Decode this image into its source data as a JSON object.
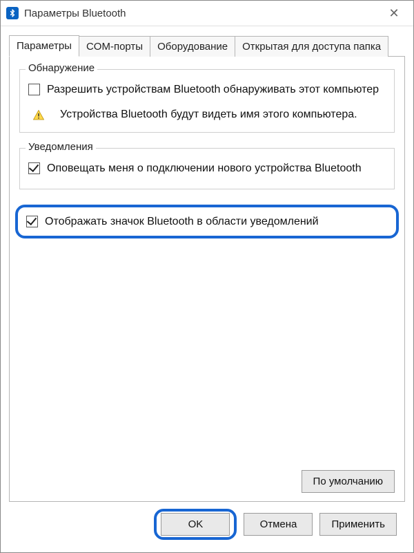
{
  "window": {
    "title": "Параметры Bluetooth",
    "close_glyph": "✕"
  },
  "tabs": [
    {
      "label": "Параметры",
      "active": true
    },
    {
      "label": "COM-порты",
      "active": false
    },
    {
      "label": "Оборудование",
      "active": false
    },
    {
      "label": "Открытая для доступа папка",
      "active": false
    }
  ],
  "groups": {
    "discovery": {
      "title": "Обнаружение",
      "allow_label": "Разрешить устройствам Bluetooth обнаруживать этот компьютер",
      "allow_checked": false,
      "info_text": "Устройства Bluetooth будут видеть имя этого компьютера."
    },
    "notifications": {
      "title": "Уведомления",
      "notify_label": "Оповещать меня о подключении нового устройства Bluetooth",
      "notify_checked": true
    }
  },
  "show_tray": {
    "label": "Отображать значок Bluetooth в области уведомлений",
    "checked": true
  },
  "buttons": {
    "defaults": "По умолчанию",
    "ok": "OK",
    "cancel": "Отмена",
    "apply": "Применить"
  },
  "colors": {
    "highlight": "#1866d3"
  }
}
